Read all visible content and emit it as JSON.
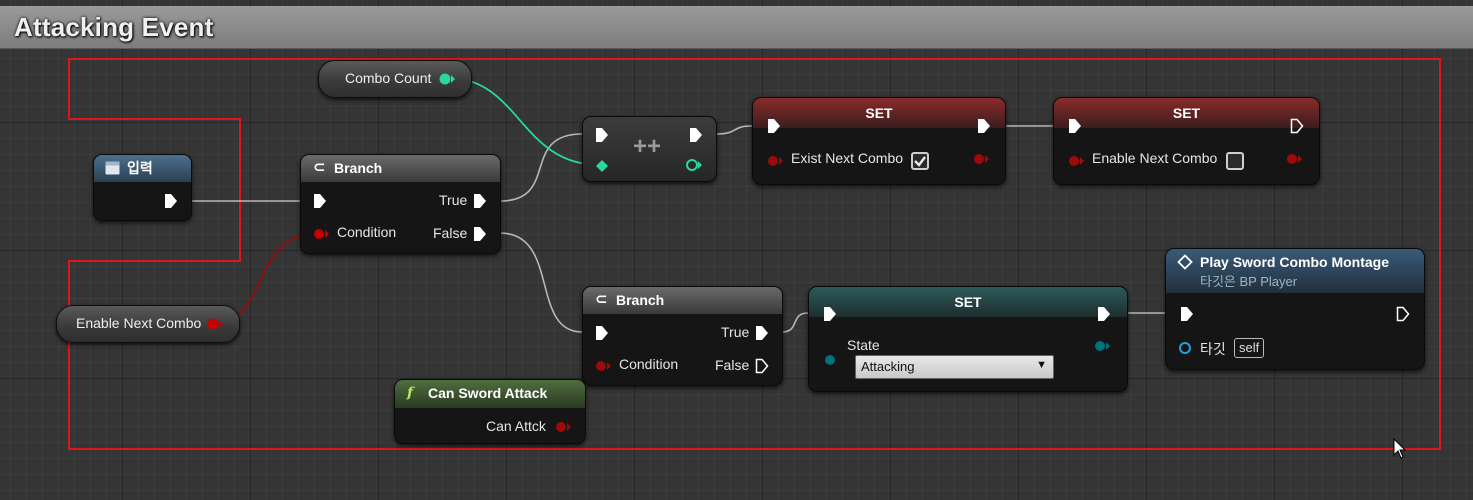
{
  "comment": {
    "title": "Attacking Event"
  },
  "colors": {
    "exec": "#ffffff",
    "bool": "#d10000",
    "int": "#29d8a0",
    "byte_enum": "#006575",
    "object": "#23a0e0",
    "selection": "#e0141b"
  },
  "nodes": {
    "input_event": {
      "title": "입력",
      "icon": "event-icon"
    },
    "branch1": {
      "title": "Branch",
      "icon": "branch-icon",
      "true_label": "True",
      "false_label": "False",
      "condition_label": "Condition"
    },
    "combo_count": {
      "label": "Combo Count"
    },
    "enable_next_combo_var": {
      "label": "Enable Next Combo"
    },
    "increment": {
      "title": "++"
    },
    "set_exist": {
      "title": "SET",
      "var_label": "Exist Next Combo",
      "checked": true
    },
    "set_enable": {
      "title": "SET",
      "var_label": "Enable Next Combo",
      "checked": false
    },
    "branch2": {
      "title": "Branch",
      "icon": "branch-icon",
      "true_label": "True",
      "false_label": "False",
      "condition_label": "Condition"
    },
    "can_sword_attack": {
      "title": "Can Sword Attack",
      "icon": "function-icon",
      "output_label": "Can Attck"
    },
    "set_state": {
      "title": "SET",
      "var_label": "State",
      "value": "Attacking"
    },
    "play_montage": {
      "title": "Play Sword Combo Montage",
      "subtitle": "타깃은 BP Player",
      "target_label": "타깃",
      "target_value": "self",
      "icon": "montage-icon"
    }
  }
}
